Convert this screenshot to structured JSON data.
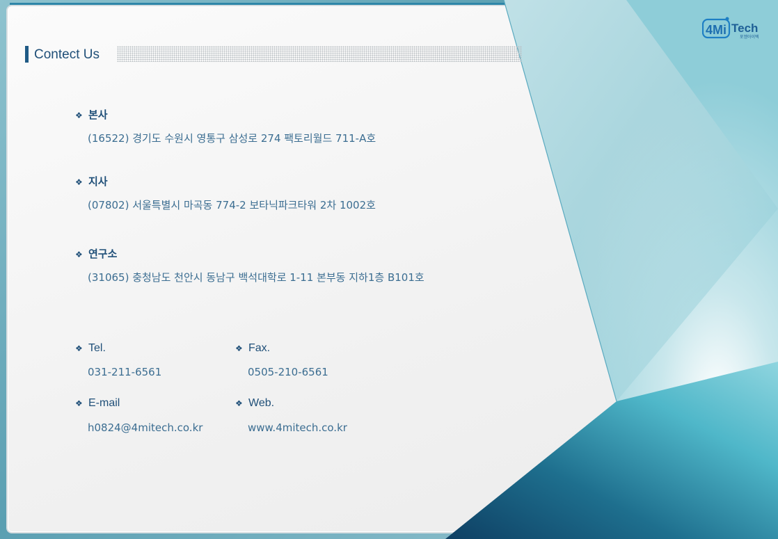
{
  "header": {
    "title": "Contect Us"
  },
  "logo": {
    "mark": "4Mi",
    "word": "Tech",
    "sub": "포엠아이텍"
  },
  "addresses": [
    {
      "label": "본사",
      "text": "(16522) 경기도 수원시 영통구 삼성로 274 팩토리월드 711-A호"
    },
    {
      "label": "지사",
      "text": "(07802) 서울특별시 마곡동 774-2 보타닉파크타워 2차 1002호"
    },
    {
      "label": "연구소",
      "text": "(31065) 충청남도 천안시 동남구 백석대학로 1-11 본부동 지하1층 B101호"
    }
  ],
  "contacts": {
    "tel": {
      "label": "Tel.",
      "value": "031-211-6561"
    },
    "fax": {
      "label": "Fax.",
      "value": "0505-210-6561"
    },
    "email": {
      "label": "E-mail",
      "value": "h0824@4mitech.co.kr"
    },
    "web": {
      "label": "Web.",
      "value": "www.4mitech.co.kr"
    }
  },
  "colors": {
    "accent": "#1f5a85",
    "text": "#3b6d91",
    "teal": "#2e9bb3"
  }
}
